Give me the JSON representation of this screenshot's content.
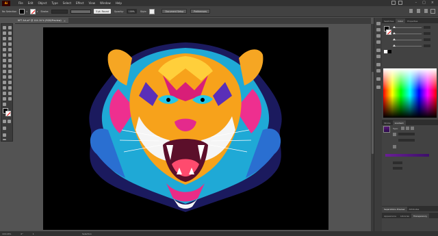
{
  "menubar": {
    "logo": "Ai",
    "menus": [
      "File",
      "Edit",
      "Object",
      "Type",
      "Select",
      "Effect",
      "View",
      "Window",
      "Help"
    ]
  },
  "controlbar": {
    "selection": "No Selection",
    "stroke_label": "Stroke:",
    "brush": "5 pt. Round",
    "opacity_label": "Opacity:",
    "opacity_value": "100%",
    "style_label": "Style:",
    "doc_setup": "Document Setup",
    "preferences": "Preferences"
  },
  "document": {
    "tab_title": "NFT Art.ai* @ 104.16 % (RGB/Preview)",
    "close": "×"
  },
  "statusbar": {
    "zoom": "104.16%",
    "angle": "0°",
    "artboard": "1",
    "tool": "Selection"
  },
  "panels": {
    "top_tabs": [
      "Swatches",
      "Color",
      "Properties"
    ],
    "mid_tabs": [
      "Stroke",
      "Gradient"
    ],
    "gradient_type_label": "Type:",
    "bottom_tabs_1": [
      "Separations Preview",
      "Attributes"
    ],
    "bottom_tabs_2": [
      "Appearance",
      "Libraries",
      "Transparency"
    ]
  },
  "colors": {
    "artboard": "#000000",
    "canvas": "#535353",
    "ui_dark": "#323232",
    "accent_logo": "#ff9a00"
  }
}
